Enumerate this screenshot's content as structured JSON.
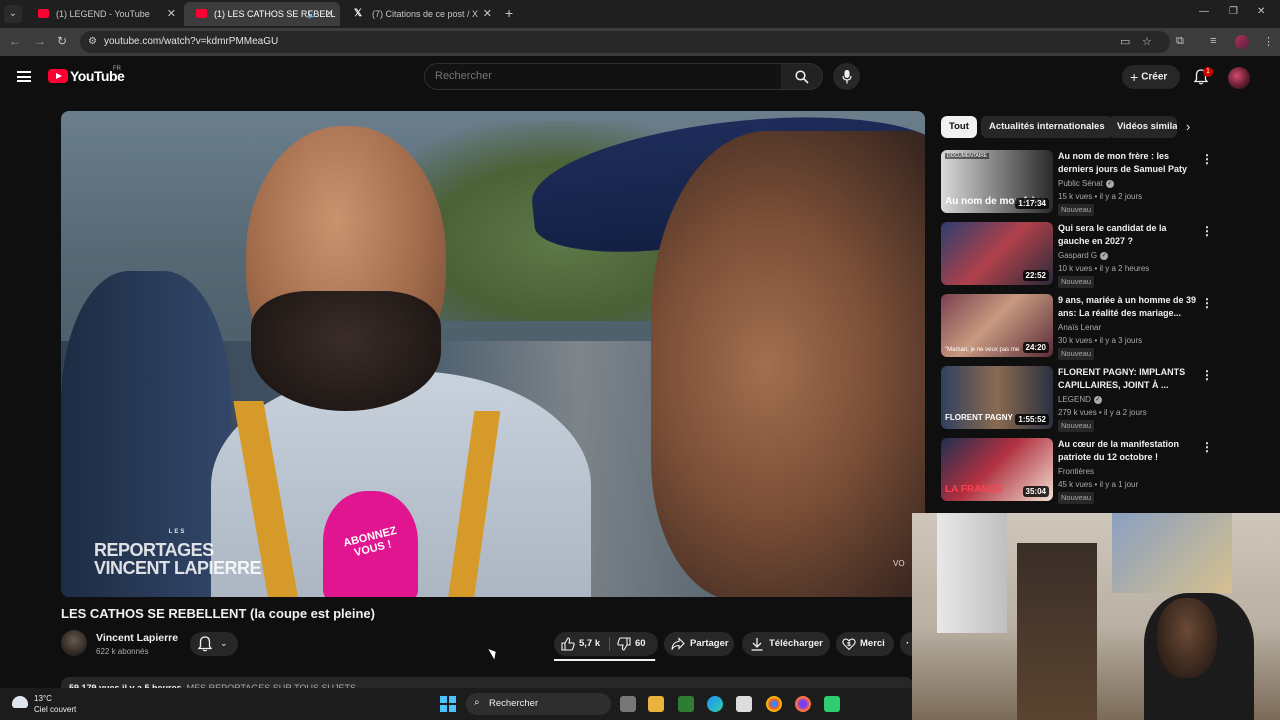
{
  "browser": {
    "tabs": [
      {
        "title": "(1) LEGEND - YouTube",
        "favicon": "youtube-icon",
        "active": false
      },
      {
        "title": "(1) LES CATHOS SE REBELL",
        "favicon": "youtube-icon",
        "active": true,
        "audio": true
      },
      {
        "title": "(7) Citations de ce post / X",
        "favicon": "x-icon",
        "active": false
      }
    ],
    "url": "youtube.com/watch?v=kdmrPMMeaGU"
  },
  "youtube": {
    "logo_text": "YouTube",
    "country_code": "FR",
    "search_placeholder": "Rechercher",
    "create_label": "Créer",
    "notification_count": "1"
  },
  "video": {
    "title": "LES CATHOS SE REBELLENT (la coupe est pleine)",
    "channel": "Vincent Lapierre",
    "subscribers": "622 k abonnés",
    "likes": "5,7 k",
    "dislikes": "60",
    "like_ratio": 0.99,
    "share_label": "Partager",
    "download_label": "Télécharger",
    "thanks_label": "Merci",
    "views_date": "59 179 vues  il y a 5 heures",
    "description_start": "MES REPORTAGES SUR TOUS SUJETS",
    "watermark_small": "LES",
    "watermark_line1": "REPORTAGES",
    "watermark_line2": "VINCENT LAPIERRE",
    "mic_text": "ABONNEZ VOUS !",
    "corner_text": "VO"
  },
  "chips": [
    "Tout",
    "Actualités internationales",
    "Vidéos simila"
  ],
  "recommendations": [
    {
      "title": "Au nom de mon frère : les derniers jours de Samuel Paty",
      "channel": "Public Sénat",
      "verified": true,
      "meta": "15 k vues • il y a 2 jours",
      "badge": "Nouveau",
      "duration": "1:17:34",
      "thumb_tag": "DOCUMENTAIRE",
      "thumb_caption": "Au nom de mon frère"
    },
    {
      "title": "Qui sera le candidat de la gauche en 2027 ?",
      "channel": "Gaspard G",
      "verified": true,
      "meta": "10 k vues • il y a 2 heures",
      "badge": "Nouveau",
      "duration": "22:52"
    },
    {
      "title": "9 ans, mariée à un homme de 39 ans: La réalité des mariage...",
      "channel": "Anaïs Lenar",
      "verified": false,
      "meta": "30 k vues • il y a 3 jours",
      "badge": "Nouveau",
      "duration": "24:20",
      "thumb_caption": "\"Maman, je ne veux pas me"
    },
    {
      "title": "FLORENT PAGNY: IMPLANTS CAPILLAIRES, JOINT À ...",
      "channel": "LEGEND",
      "verified": true,
      "meta": "279 k vues • il y a 2 jours",
      "badge": "Nouveau",
      "duration": "1:55:52",
      "thumb_caption": "FLORENT PAGNY"
    },
    {
      "title": "Au cœur de la manifestation patriote du 12 octobre !",
      "channel": "Frontières",
      "verified": false,
      "meta": "45 k vues • il y a 1 jour",
      "badge": "Nouveau",
      "duration": "35:04",
      "thumb_caption": "LA FRANCE"
    }
  ],
  "taskbar": {
    "temperature": "13°C",
    "weather": "Ciel couvert",
    "search_label": "Rechercher"
  },
  "colors": {
    "background": "#0f0f0f",
    "youtube_red": "#ff0033",
    "chip_bg": "#272727",
    "mic_pink": "#e0158f"
  }
}
